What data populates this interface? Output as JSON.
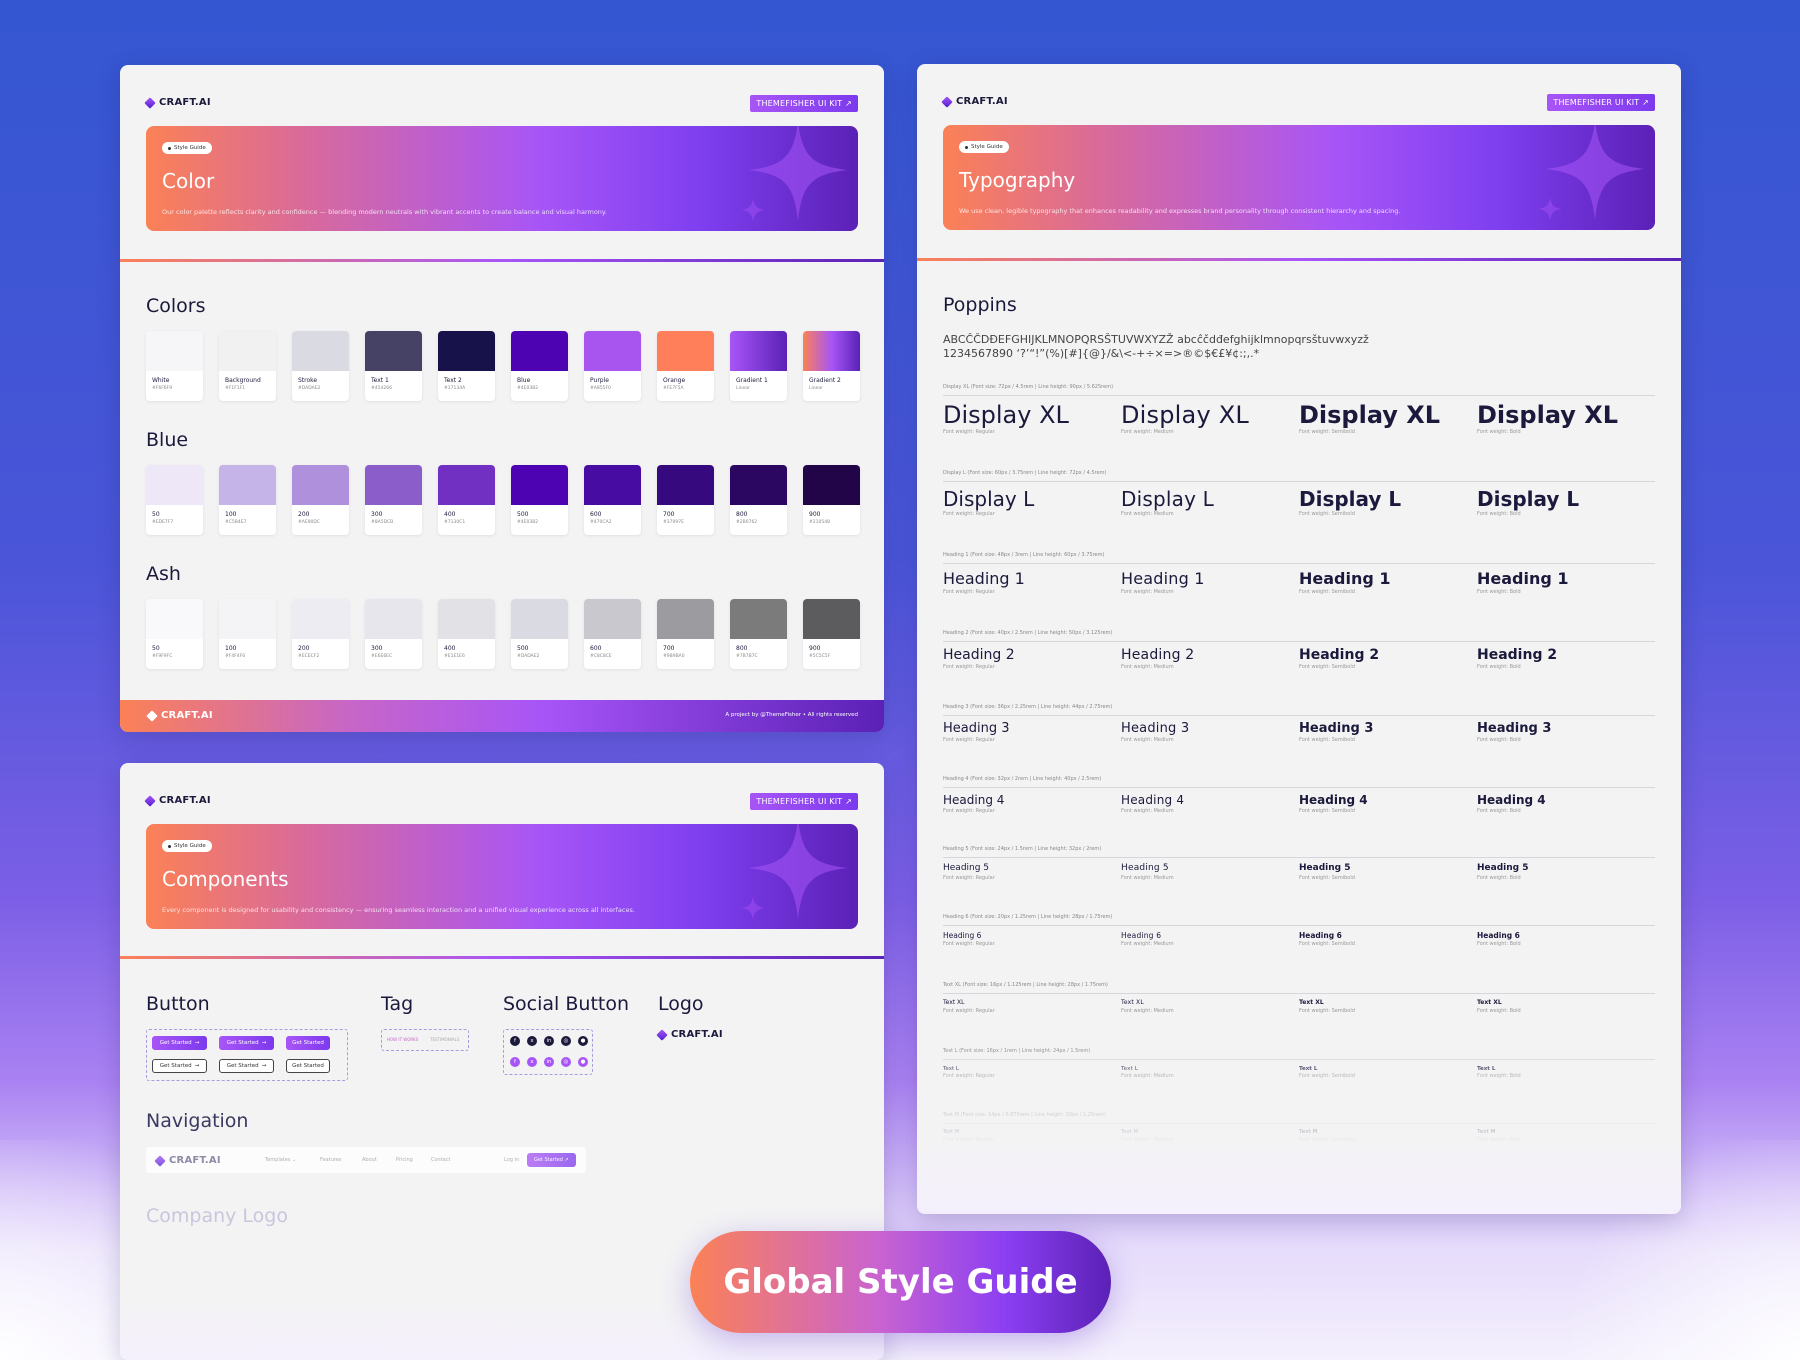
{
  "brand": "CRAFT.AI",
  "kit_button": "THEMEFISHER UI KIT ↗",
  "pill": "Style Guide",
  "color_card": {
    "title": "Color",
    "desc": "Our color palette reflects clarity and confidence — blending modern neutrals with vibrant accents to create balance and visual harmony.",
    "sections": [
      {
        "title": "Colors",
        "swatches": [
          {
            "name": "White",
            "hex": "#F6F6F9",
            "color": "#f6f6f9"
          },
          {
            "name": "Background",
            "hex": "#F1F1F1",
            "color": "#f1f1f1"
          },
          {
            "name": "Stroke",
            "hex": "#DADAE2",
            "color": "#dadae2"
          },
          {
            "name": "Text 1",
            "hex": "#454266",
            "color": "#454266"
          },
          {
            "name": "Text 2",
            "hex": "#17134A",
            "color": "#17134a"
          },
          {
            "name": "Blue",
            "hex": "#4E03B2",
            "color": "#4e03b2"
          },
          {
            "name": "Purple",
            "hex": "#A855F0",
            "color": "#a855f0"
          },
          {
            "name": "Orange",
            "hex": "#FE7F5A",
            "color": "#fe7f5a"
          },
          {
            "name": "Gradient 1",
            "hex": "Linear",
            "color": "linear-gradient(90deg,#a855f7,#5b21b6)"
          },
          {
            "name": "Gradient 2",
            "hex": "Linear",
            "color": "linear-gradient(90deg,#fb8156,#a855f7,#5b21b6)"
          }
        ]
      },
      {
        "title": "Blue",
        "swatches": [
          {
            "name": "50",
            "hex": "#EDE7F7",
            "color": "#ede7f7"
          },
          {
            "name": "100",
            "hex": "#C5B4E7",
            "color": "#c5b4e7"
          },
          {
            "name": "200",
            "hex": "#AE90DC",
            "color": "#ae90dc"
          },
          {
            "name": "300",
            "hex": "#8A5DCB",
            "color": "#8a5dcb"
          },
          {
            "name": "400",
            "hex": "#7130C1",
            "color": "#7130c1"
          },
          {
            "name": "500",
            "hex": "#4E03B2",
            "color": "#4e03b2"
          },
          {
            "name": "600",
            "hex": "#470CA2",
            "color": "#470ca2"
          },
          {
            "name": "700",
            "hex": "#37097E",
            "color": "#37097e"
          },
          {
            "name": "800",
            "hex": "#2B0762",
            "color": "#2b0762"
          },
          {
            "name": "900",
            "hex": "#210548",
            "color": "#210548"
          }
        ]
      },
      {
        "title": "Ash",
        "swatches": [
          {
            "name": "50",
            "hex": "#F9F9FC",
            "color": "#f9f9fc"
          },
          {
            "name": "100",
            "hex": "#F4F4F6",
            "color": "#f4f4f6"
          },
          {
            "name": "200",
            "hex": "#ECECF2",
            "color": "#ececf2"
          },
          {
            "name": "300",
            "hex": "#E6E6EC",
            "color": "#e6e6ec"
          },
          {
            "name": "400",
            "hex": "#E1E1E6",
            "color": "#e1e1e6"
          },
          {
            "name": "500",
            "hex": "#DADAE2",
            "color": "#dadae2"
          },
          {
            "name": "600",
            "hex": "#C8C8CE",
            "color": "#c8c8ce"
          },
          {
            "name": "700",
            "hex": "#9B9BA0",
            "color": "#9b9ba0"
          },
          {
            "name": "800",
            "hex": "#7B7B7C",
            "color": "#7b7b7c"
          },
          {
            "name": "900",
            "hex": "#5C5C5F",
            "color": "#5c5c5f"
          }
        ]
      }
    ],
    "footer_right": "A project by @ThemeFisher  •  All rights reserved"
  },
  "components_card": {
    "title": "Components",
    "desc": "Every component is designed for usability and consistency — ensuring seamless interaction and a unified visual experience across all interfaces.",
    "button_title": "Button",
    "tag_title": "Tag",
    "social_title": "Social Button",
    "logo_title": "Logo",
    "button_label": "Get Started",
    "tags": [
      "HOW IT WORKS",
      "TESTIMONIALS"
    ],
    "navigation_title": "Navigation",
    "nav_links": [
      "Templates ⌄",
      "Features",
      "About",
      "Pricing",
      "Contact"
    ],
    "nav_login": "Log in",
    "nav_cta": "Get Started ↗",
    "company_logo_title": "Company Logo"
  },
  "typography_card": {
    "title": "Typography",
    "desc": "We use clean, legible typography that enhances readability and expresses brand personality through consistent hierarchy and spacing.",
    "font_name": "Poppins",
    "glyphs_1": "ABCĈČDĐEFGHIJKLMNOPQRSŠTUVWXYZŽ abcĉčdđefghijklmnopqrsštuvwxyzž",
    "glyphs_2": "1234567890 ‘?’“!”(%)[#]{@}/&\\<-+÷×=>®©$€£¥¢:;,.*",
    "weights": [
      "Font weight: Regular",
      "Font weight: Medium",
      "Font weight: Semibold",
      "Font weight: Bold"
    ],
    "styles": [
      {
        "name": "Display XL",
        "spec": "Display XL  (Font size: 72px / 4.5rem  |  Line height: 90px / 5.625rem)"
      },
      {
        "name": "Display L",
        "spec": "Display L  (Font size: 60px / 3.75rem  |  Line height: 72px / 4.5rem)"
      },
      {
        "name": "Heading 1",
        "spec": "Heading 1  (Font size: 48px / 3rem  |  Line height: 60px / 3.75rem)"
      },
      {
        "name": "Heading 2",
        "spec": "Heading 2  (Font size: 40px / 2.5rem  |  Line height: 50px / 3.125rem)"
      },
      {
        "name": "Heading 3",
        "spec": "Heading 3  (Font size: 36px / 2.25rem  |  Line height: 44px / 2.75rem)"
      },
      {
        "name": "Heading 4",
        "spec": "Heading 4  (Font size: 32px / 2rem  |  Line height: 40px / 2.5rem)"
      },
      {
        "name": "Heading 5",
        "spec": "Heading 5  (Font size: 24px / 1.5rem  |  Line height: 32px / 2rem)"
      },
      {
        "name": "Heading 6",
        "spec": "Heading 6  (Font size: 20px / 1.25rem  |  Line height: 28px / 1.75rem)"
      },
      {
        "name": "Text XL",
        "spec": "Text XL  (Font size: 16px / 1.125rem  |  Line height: 28px / 1.75rem)"
      },
      {
        "name": "Text L",
        "spec": "Text L  (Font size: 16px / 1rem  |  Line height: 24px / 1.5rem)"
      },
      {
        "name": "Text M",
        "spec": "Text M  (Font size: 14px / 0.875rem  |  Line height: 20px / 1.25rem)"
      }
    ]
  },
  "cta": "Global Style Guide"
}
